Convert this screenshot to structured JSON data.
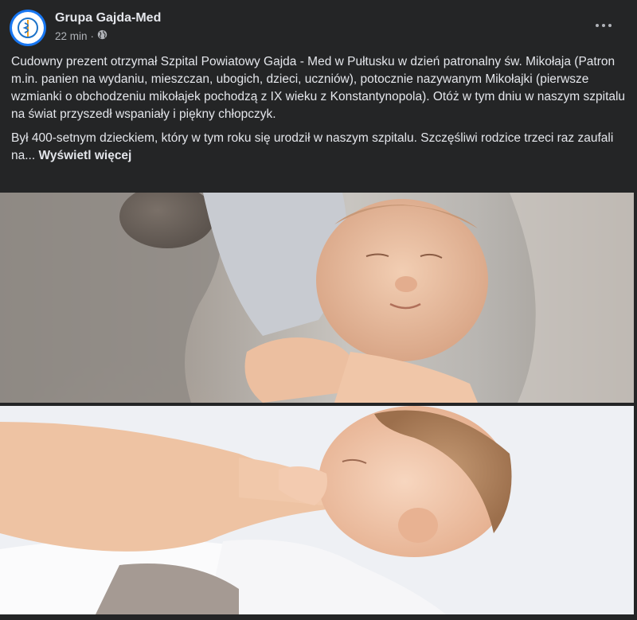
{
  "post": {
    "page_name": "Grupa Gajda-Med",
    "time": "22 min",
    "separator": "·",
    "privacy_icon": "globe-icon",
    "more_icon": "more-dots-icon",
    "paragraphs": [
      "Cudowny prezent otrzymał Szpital Powiatowy Gajda - Med w Pułtusku w dzień patronalny św. Mikołaja (Patron m.in. panien na wydaniu, mieszczan, ubogich, dzieci, uczniów), potocznie nazywanym Mikołajki (pierwsze wzmianki o obchodzeniu mikołajek pochodzą z IX wieku z Konstantynopola). Otóż w tym dniu w naszym szpitalu na świat przyszedł wspaniały i piękny chłopczyk.",
      "Był 400-setnym dzieckiem, który w tym roku się urodził w naszym szpitalu. Szczęśliwi rodzice trzeci raz zaufali na..."
    ],
    "see_more": "Wyświetl więcej"
  },
  "colors": {
    "background": "#242526",
    "text": "#e4e6eb",
    "secondary": "#b0b3b8",
    "avatar_ring": "#1877f2"
  }
}
